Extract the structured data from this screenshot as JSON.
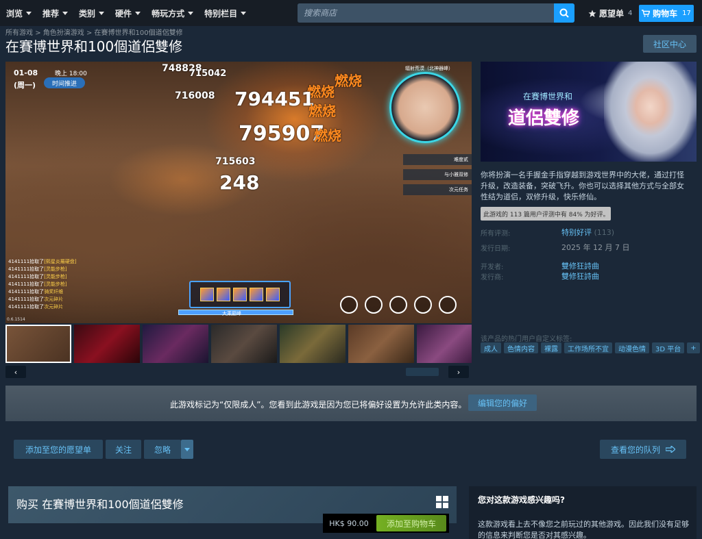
{
  "nav": {
    "items": [
      "浏览",
      "推荐",
      "类别",
      "硬件",
      "畅玩方式",
      "特别栏目"
    ],
    "search_placeholder": "搜索商店",
    "wishlist_label": "愿望单",
    "wishlist_count": "4",
    "cart_label": "购物车",
    "cart_count": "17"
  },
  "breadcrumb": [
    "所有游戏",
    "角色扮演游戏",
    "在賽博世界和100個道侶雙修"
  ],
  "breadcrumb_sep": ">",
  "title": "在賽博世界和100個道侶雙修",
  "community_label": "社区中心",
  "screenshot": {
    "date": "01-08",
    "weekday": "(周一)",
    "time": "晚上 18:00",
    "advance": "时间推进",
    "minimap_label": "辐射荒漠（北神器峰）",
    "difficulty": "难度贰",
    "quests": [
      "与小雅双修",
      "次元任务"
    ],
    "battle_log": [
      {
        "who": "4141111拾取了",
        "item": "[熙星炎羅硬盘]"
      },
      {
        "who": "4141111拾取了",
        "item": "[灵能步枪]"
      },
      {
        "who": "4141111拾取了",
        "item": "[灵能步枪]"
      },
      {
        "who": "4141111拾取了",
        "item": "[灵能步枪]"
      },
      {
        "who": "4141111拾取了",
        "item": "骑奖纤维"
      },
      {
        "who": "4141111拾取了",
        "item": "次元碎片"
      },
      {
        "who": "4141111拾取了",
        "item": "次元碎片"
      }
    ],
    "damage": [
      "716008",
      "794451",
      "715603",
      "248",
      "795907",
      "715042",
      "748828"
    ],
    "burn_label": "燃烧",
    "hp_label": "大乘巅峰",
    "version": "0.6.1514"
  },
  "capsule": {
    "title": "道侶雙修",
    "sub": "在賽博世界和"
  },
  "description": "你将扮演一名手握金手指穿越到游戏世界中的大佬，通过打怪升级，改造装备，突破飞升。你也可以选择其他方式与全部女性结为道侣，双修升级，快乐修仙。",
  "review_tip": "此游戏的 113 篇用户评测中有 84% 为好评。",
  "reviews": {
    "label": "所有评测:",
    "value": "特别好评",
    "count": "(113)"
  },
  "release": {
    "label": "发行日期:",
    "value": "2025 年 12 月 7 日"
  },
  "developer": {
    "label": "开发者:",
    "value": "雙修狂詩曲"
  },
  "publisher": {
    "label": "发行商:",
    "value": "雙修狂詩曲"
  },
  "tags_label": "该产品的热门用户自定义标签:",
  "tags": [
    "成人",
    "色情内容",
    "裸露",
    "工作场所不宜",
    "动漫色情",
    "3D 平台",
    "+"
  ],
  "notice": {
    "text": "此游戏标记为“仅限成人”。您看到此游戏是因为您已将偏好设置为允许此类内容。",
    "button": "编辑您的偏好"
  },
  "actions": {
    "wishlist": "添加至您的愿望单",
    "follow": "关注",
    "ignore": "忽略",
    "queue": "查看您的队列"
  },
  "purchase": {
    "title": "购买 在賽博世界和100個道侶雙修",
    "price": "HK$ 90.00",
    "button": "添加至购物车"
  },
  "interest": {
    "title": "您对这款游戏感兴趣吗?",
    "text": "这款游戏看上去不像您之前玩过的其他游戏。因此我们没有足够的信息来判断您是否对其感兴趣。"
  },
  "colors": {
    "bg": "#1b2838",
    "nav": "#171d25",
    "accent": "#1a9fff",
    "link": "#66c0f4",
    "buy": "#75b022"
  }
}
